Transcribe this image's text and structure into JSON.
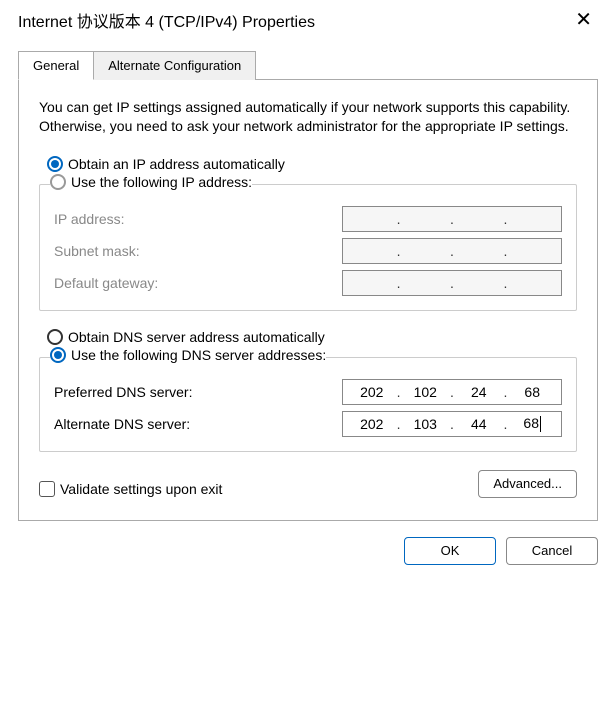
{
  "window": {
    "title": "Internet 协议版本 4 (TCP/IPv4) Properties"
  },
  "tabs": {
    "general": "General",
    "alternate": "Alternate Configuration"
  },
  "description": "You can get IP settings assigned automatically if your network supports this capability. Otherwise, you need to ask your network administrator for the appropriate IP settings.",
  "ip_section": {
    "obtain_auto": "Obtain an IP address automatically",
    "use_following": "Use the following IP address:",
    "ip_label": "IP address:",
    "subnet_label": "Subnet mask:",
    "gateway_label": "Default gateway:",
    "ip_value": [
      "",
      "",
      "",
      ""
    ],
    "subnet_value": [
      "",
      "",
      "",
      ""
    ],
    "gateway_value": [
      "",
      "",
      "",
      ""
    ]
  },
  "dns_section": {
    "obtain_auto": "Obtain DNS server address automatically",
    "use_following": "Use the following DNS server addresses:",
    "preferred_label": "Preferred DNS server:",
    "alternate_label": "Alternate DNS server:",
    "preferred_value": [
      "202",
      "102",
      "24",
      "68"
    ],
    "alternate_value": [
      "202",
      "103",
      "44",
      "68"
    ]
  },
  "validate_label": "Validate settings upon exit",
  "buttons": {
    "advanced": "Advanced...",
    "ok": "OK",
    "cancel": "Cancel"
  }
}
